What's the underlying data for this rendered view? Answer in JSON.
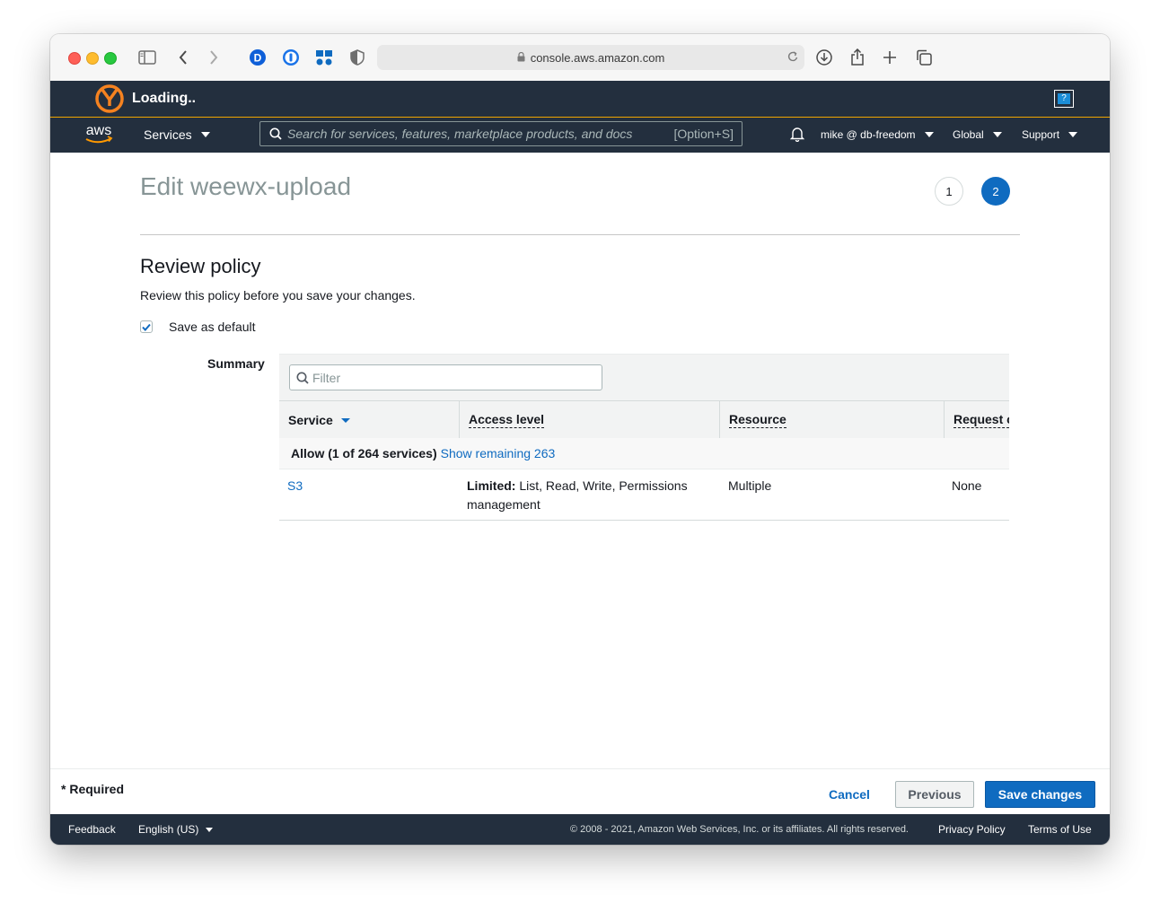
{
  "browser": {
    "url": "console.aws.amazon.com",
    "extension_icons": [
      "dashlane-icon",
      "1password-icon",
      "bitwarden-icon",
      "shield-icon"
    ]
  },
  "loading": {
    "text": "Loading..",
    "help_label": "?"
  },
  "nav": {
    "logo_text": "aws",
    "services_label": "Services",
    "search_placeholder": "Search for services, features, marketplace products, and docs",
    "search_shortcut": "[Option+S]",
    "account": "mike @ db-freedom",
    "region": "Global",
    "support": "Support"
  },
  "page": {
    "title": "Edit weewx-upload",
    "steps": [
      "1",
      "2"
    ],
    "active_step": "2",
    "section_title": "Review policy",
    "section_description": "Review this policy before you save your changes.",
    "save_default_label": "Save as default",
    "save_default_checked": true,
    "summary_label": "Summary",
    "filter_placeholder": "Filter",
    "table": {
      "columns": [
        "Service",
        "Access level",
        "Resource",
        "Request c"
      ],
      "group_row": {
        "label": "Allow (1 of 264 services)",
        "link": "Show remaining 263"
      },
      "rows": [
        {
          "service": "S3",
          "access_prefix": "Limited:",
          "access_rest": "List, Read, Write, Permissions",
          "access_rest_line2": "management",
          "resource": "Multiple",
          "request": "None"
        }
      ]
    }
  },
  "actions": {
    "required_note": "* Required",
    "cancel": "Cancel",
    "previous": "Previous",
    "save": "Save changes"
  },
  "footer": {
    "feedback": "Feedback",
    "language": "English (US)",
    "copyright": "© 2008 - 2021, Amazon Web Services, Inc. or its affiliates. All rights reserved.",
    "privacy": "Privacy Policy",
    "terms": "Terms of Use"
  },
  "colors": {
    "aws_navy": "#232f3e",
    "accent_blue": "#0f6bc0",
    "aws_orange": "#ff9900"
  }
}
